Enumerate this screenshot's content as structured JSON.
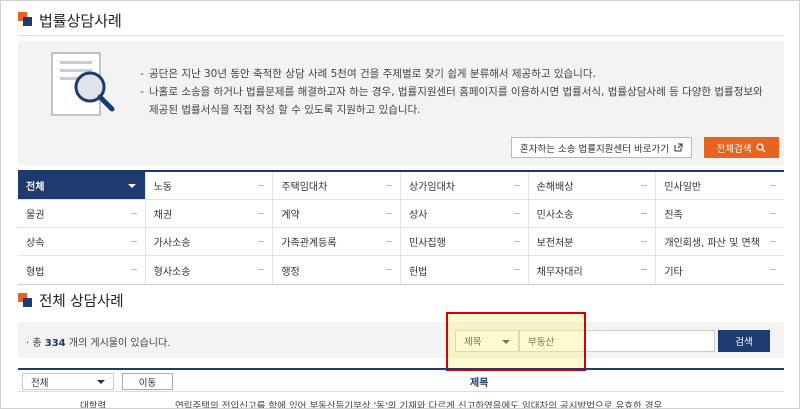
{
  "page_title": "법률상담사례",
  "info": {
    "lines": [
      "공단은 지난 30년 동안 축적한 상담 사례 5천여 건을 주제별로 찾기 쉽게 분류해서 제공하고 있습니다.",
      "나홀로 소송을 하거나 법률문제를 해결하고자 하는 경우, 법률지원센터 홈페이지를 이용하시면 법률서식, 법률상담사례 등 다양한 법률정보와 제공된 법률서식을 직접 작성 할 수 있도록 지원하고 있습니다."
    ],
    "link_button": "혼자하는 소송 법률지원센터 바로가기",
    "search_button": "전체검색"
  },
  "categories": [
    "전체",
    "노동",
    "주택임대차",
    "상가임대차",
    "손해배상",
    "민사일반",
    "물권",
    "채권",
    "계약",
    "상사",
    "민사소송",
    "친족",
    "상속",
    "가사소송",
    "가족관계등록",
    "민사집행",
    "보전처분",
    "개인회생, 파산 및 면책",
    "형법",
    "형사소송",
    "행정",
    "헌법",
    "채무자대리",
    "기타"
  ],
  "active_category": "전체",
  "list_title": "전체 상담사례",
  "search": {
    "count_prefix": "총",
    "count": "334",
    "count_suffix": "개의 게시물이 있습니다.",
    "field_select": "제목",
    "keyword": "부동산",
    "button": "검색"
  },
  "list_head": {
    "filter_select": "전체",
    "move_button": "이동",
    "column_title": "제목"
  },
  "rows": [
    {
      "category": "대항력",
      "subject": "연립주택의 전입신고를 함에 있어 부동산등기부상 '동'의 기재와 다르게 신고하였음에도 임대차의 공시방법으로 유효한 경우"
    }
  ],
  "colors": {
    "accent": "#e8641e",
    "navy": "#1f3a6e",
    "highlight_border": "#d80000"
  }
}
